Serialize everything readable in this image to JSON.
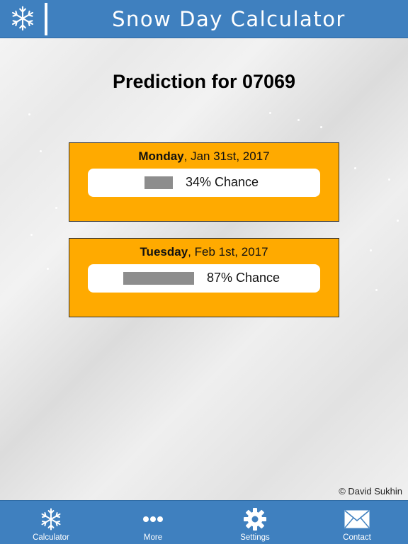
{
  "header": {
    "title": "Snow Day Calculator",
    "logo_icon": "snowflake-icon"
  },
  "main": {
    "headline": "Prediction for 07069",
    "days": [
      {
        "day": "Monday",
        "date": ", Jan 31st, 2017",
        "chance_label": "34% Chance",
        "chance_percent": 34
      },
      {
        "day": "Tuesday",
        "date": ", Feb 1st, 2017",
        "chance_label": "87% Chance",
        "chance_percent": 87
      }
    ]
  },
  "footer": {
    "copyright": "© David Sukhin"
  },
  "tabbar": {
    "tabs": [
      {
        "label": "Calculator",
        "icon": "snowflake-icon"
      },
      {
        "label": "More",
        "icon": "more-dots-icon"
      },
      {
        "label": "Settings",
        "icon": "gear-icon"
      },
      {
        "label": "Contact",
        "icon": "mail-icon"
      }
    ]
  },
  "colors": {
    "header": "#3f80bf",
    "card": "#ffaa00",
    "bar": "#8d8d8d"
  }
}
